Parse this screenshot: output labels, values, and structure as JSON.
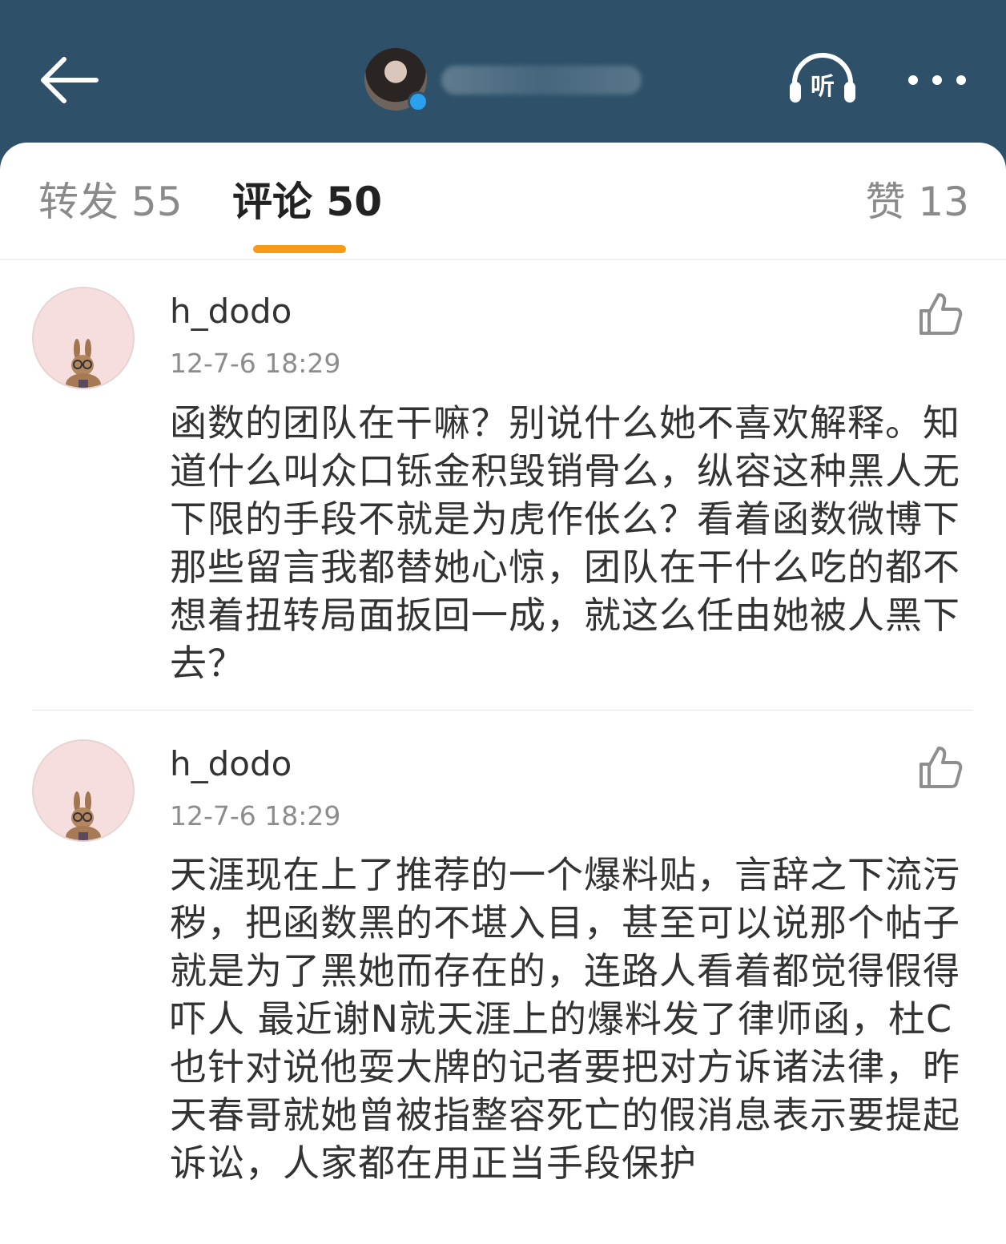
{
  "tabs": {
    "repost": "转发 55",
    "comments": "评论 50",
    "likes": "赞 13"
  },
  "header": {
    "listen_label": "听"
  },
  "comments": [
    {
      "user": "h_dodo",
      "time": "12-7-6 18:29",
      "text": "函数的团队在干嘛？别说什么她不喜欢解释。知道什么叫众口铄金积毁销骨么，纵容这种黑人无下限的手段不就是为虎作伥么？看着函数微博下那些留言我都替她心惊，团队在干什么吃的都不想着扭转局面扳回一成，就这么任由她被人黑下去？"
    },
    {
      "user": "h_dodo",
      "time": "12-7-6 18:29",
      "text": "天涯现在上了推荐的一个爆料贴，言辞之下流污秽，把函数黑的不堪入目，甚至可以说那个帖子就是为了黑她而存在的，连路人看着都觉得假得吓人 最近谢N就天涯上的爆料发了律师函，杜C也针对说他耍大牌的记者要把对方诉诸法律，昨天春哥就她曾被指整容死亡的假消息表示要提起诉讼，人家都在用正当手段保护"
    }
  ],
  "icons": {
    "back": "arrow-left-icon",
    "listen": "headphones-icon",
    "more": "more-dots-icon",
    "like": "thumbs-up-icon"
  },
  "colors": {
    "header_bg": "#2e5169",
    "tab_indicator": "#f79b16",
    "verified": "#2aa0ee",
    "avatar_bg": "#f7dede"
  }
}
